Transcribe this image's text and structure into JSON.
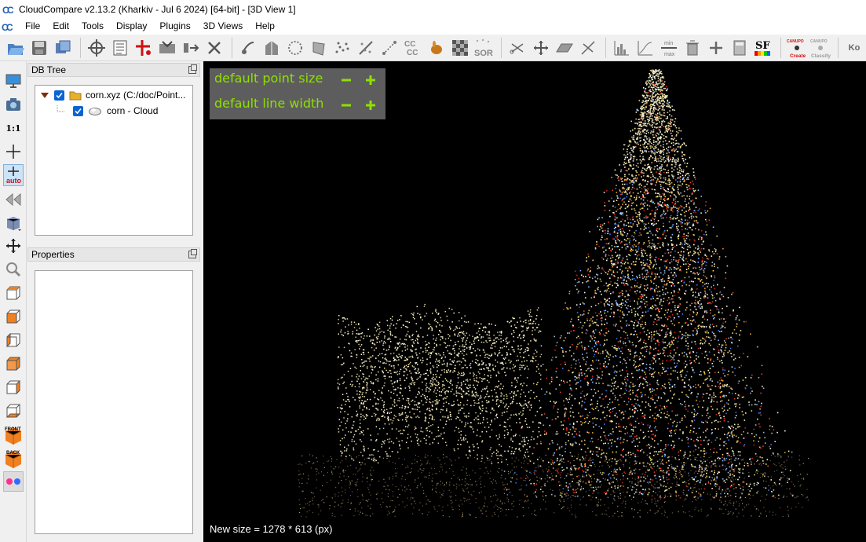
{
  "window": {
    "title": "CloudCompare v2.13.2 (Kharkiv - Jul  6 2024) [64-bit] - [3D View 1]"
  },
  "menu": [
    "File",
    "Edit",
    "Tools",
    "Display",
    "Plugins",
    "3D Views",
    "Help"
  ],
  "toolbar": {
    "icons": [
      "open-icon",
      "save-icon",
      "clone-icon",
      "point-picking-icon",
      "list-icon",
      "point-pair-icon",
      "segment-icon",
      "merge-icon",
      "delete-icon",
      "normals-icon",
      "octree-icon",
      "sample-icon",
      "subsample-icon",
      "sor-icon",
      "scale-icon",
      "noise-icon"
    ],
    "cc_label": "CC\nCC",
    "sor_label": "SOR",
    "sf_label": "SF",
    "canupo_create_top": "CANUPO",
    "canupo_create_label": "Create",
    "canupo_classify_top": "CANUPO",
    "canupo_classify_label": "Classify",
    "minmax_top": "min",
    "minmax_bottom": "max",
    "ko_label": "Ko"
  },
  "left_toolbar": {
    "ratio_label": "1:1",
    "auto_label": "auto",
    "front_label": "FRONT",
    "back_label": "BACK"
  },
  "db_tree": {
    "title": "DB Tree",
    "items": [
      {
        "label": "corn.xyz (C:/doc/Point...",
        "checked": true,
        "icon": "folder-icon"
      },
      {
        "label": "corn - Cloud",
        "checked": true,
        "icon": "cloud-icon"
      }
    ]
  },
  "properties": {
    "title": "Properties"
  },
  "view3d": {
    "overlay": {
      "point_size_label": "default point size",
      "line_width_label": "default line width"
    },
    "status": "New size = 1278 * 613 (px)"
  },
  "colors": {
    "overlay_text": "#8ee000",
    "overlay_bg": "#5d5d5d",
    "checkbox": "#0a64d2"
  }
}
